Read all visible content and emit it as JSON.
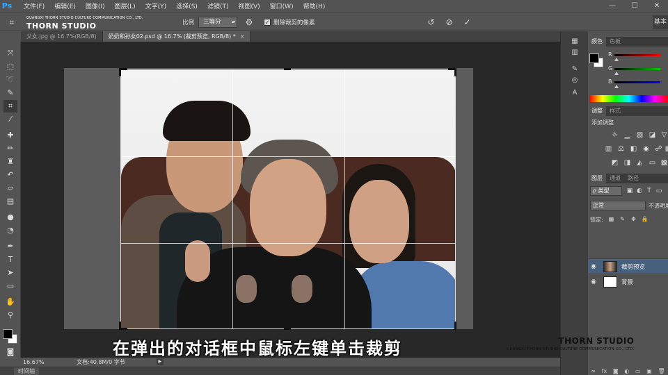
{
  "app": {
    "logo": "Ps"
  },
  "menubar": {
    "items": [
      "文件(F)",
      "编辑(E)",
      "图像(I)",
      "图层(L)",
      "文字(Y)",
      "选择(S)",
      "滤镜(T)",
      "视图(V)",
      "窗口(W)",
      "帮助(H)"
    ],
    "window_controls": [
      "—",
      "☐",
      "✕"
    ]
  },
  "optionsbar": {
    "ratio_label": "比例",
    "ratio_value": "三等分",
    "delete_cropped_label": "删除裁剪的像素",
    "workspace_label": "基本"
  },
  "watermark_top": {
    "small": "GUANGXI THORN STUDIO CULTURE COMMUNICATION CO., LTD.",
    "big": "THORN STUDIO"
  },
  "tabs": [
    {
      "label": "父女.jpg @ 16.7%(RGB/8)",
      "active": false,
      "close": ""
    },
    {
      "label": "奶奶和孙女02.psd @ 16.7% (裁剪预览, RGB/8) *",
      "active": true,
      "close": "×"
    }
  ],
  "toolbar": {
    "icons": [
      "move-icon",
      "marquee-icon",
      "lasso-icon",
      "quick-select-icon",
      "crop-icon",
      "eyedropper-icon",
      "healing-icon",
      "brush-icon",
      "stamp-icon",
      "history-brush-icon",
      "eraser-icon",
      "gradient-icon",
      "blur-icon",
      "dodge-icon",
      "pen-icon",
      "type-icon",
      "path-select-icon",
      "shape-icon",
      "hand-icon",
      "zoom-icon"
    ],
    "active_tool": "crop-icon"
  },
  "subtitle": "在弹出的对话框中鼠标左键单击裁剪",
  "statusbar": {
    "zoom": "16.67%",
    "doc_info": "文档:40.8M/0 字节",
    "arrow": "▶"
  },
  "timeline": {
    "label": "时间轴"
  },
  "color_panel": {
    "tabs": [
      "颜色",
      "色板"
    ],
    "channels": [
      "R",
      "G",
      "B"
    ],
    "colors": {
      "r": "#ff0000",
      "g": "#00cc00",
      "b": "#0000ff"
    }
  },
  "adjust_panel": {
    "tabs": [
      "调整",
      "样式"
    ],
    "title": "添加调整"
  },
  "layers_panel": {
    "tabs": [
      "图层",
      "通道",
      "路径"
    ],
    "filter": "ρ 类型",
    "blend_mode": "正常",
    "opacity_label": "不透明度:",
    "lock_label": "锁定:",
    "layers": [
      {
        "name": "裁剪预览",
        "active": true
      },
      {
        "name": "背景",
        "active": false
      }
    ],
    "footer_icons": [
      "∞",
      "fx",
      "◙",
      "◐",
      "▭",
      "▣",
      "🗑"
    ]
  },
  "watermark_br": {
    "big": "THORN STUDIO",
    "small": "GUANGXI THORN STUDIO CULTURE COMMUNICATION CO., LTD."
  },
  "selection_color": "#47607d"
}
